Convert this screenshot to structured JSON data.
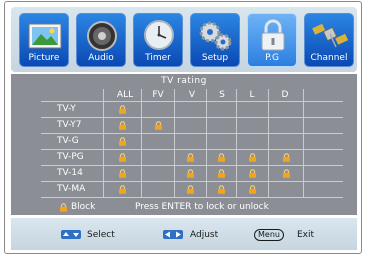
{
  "tabs": [
    {
      "label": "Picture",
      "icon": "picture-icon",
      "active": false
    },
    {
      "label": "Audio",
      "icon": "speaker-icon",
      "active": false
    },
    {
      "label": "Timer",
      "icon": "clock-icon",
      "active": false
    },
    {
      "label": "Setup",
      "icon": "gears-icon",
      "active": false
    },
    {
      "label": "P.G",
      "icon": "padlock-icon",
      "active": true
    },
    {
      "label": "Channel",
      "icon": "satellite-icon",
      "active": false
    }
  ],
  "rating": {
    "title": "TV rating",
    "columns": [
      "ALL",
      "FV",
      "V",
      "S",
      "L",
      "D"
    ],
    "rows": [
      {
        "label": "TV-Y",
        "locks": [
          true,
          false,
          false,
          false,
          false,
          false
        ]
      },
      {
        "label": "TV-Y7",
        "locks": [
          true,
          true,
          false,
          false,
          false,
          false
        ]
      },
      {
        "label": "TV-G",
        "locks": [
          true,
          false,
          false,
          false,
          false,
          false
        ]
      },
      {
        "label": "TV-PG",
        "locks": [
          true,
          false,
          true,
          true,
          true,
          true
        ]
      },
      {
        "label": "TV-14",
        "locks": [
          true,
          false,
          true,
          true,
          true,
          true
        ]
      },
      {
        "label": "TV-MA",
        "locks": [
          true,
          false,
          true,
          true,
          true,
          false
        ]
      }
    ],
    "legend_label": "Block",
    "instruction": "Press ENTER to lock or unlock"
  },
  "footer": {
    "select_label": "Select",
    "adjust_label": "Adjust",
    "menu_key": "Menu",
    "exit_label": "Exit"
  },
  "colors": {
    "tab_blue": "#0a49b4",
    "tab_active": "#6fb3f6",
    "panel_gray": "#8b8f95",
    "lock_gold": "#f2a51c"
  }
}
